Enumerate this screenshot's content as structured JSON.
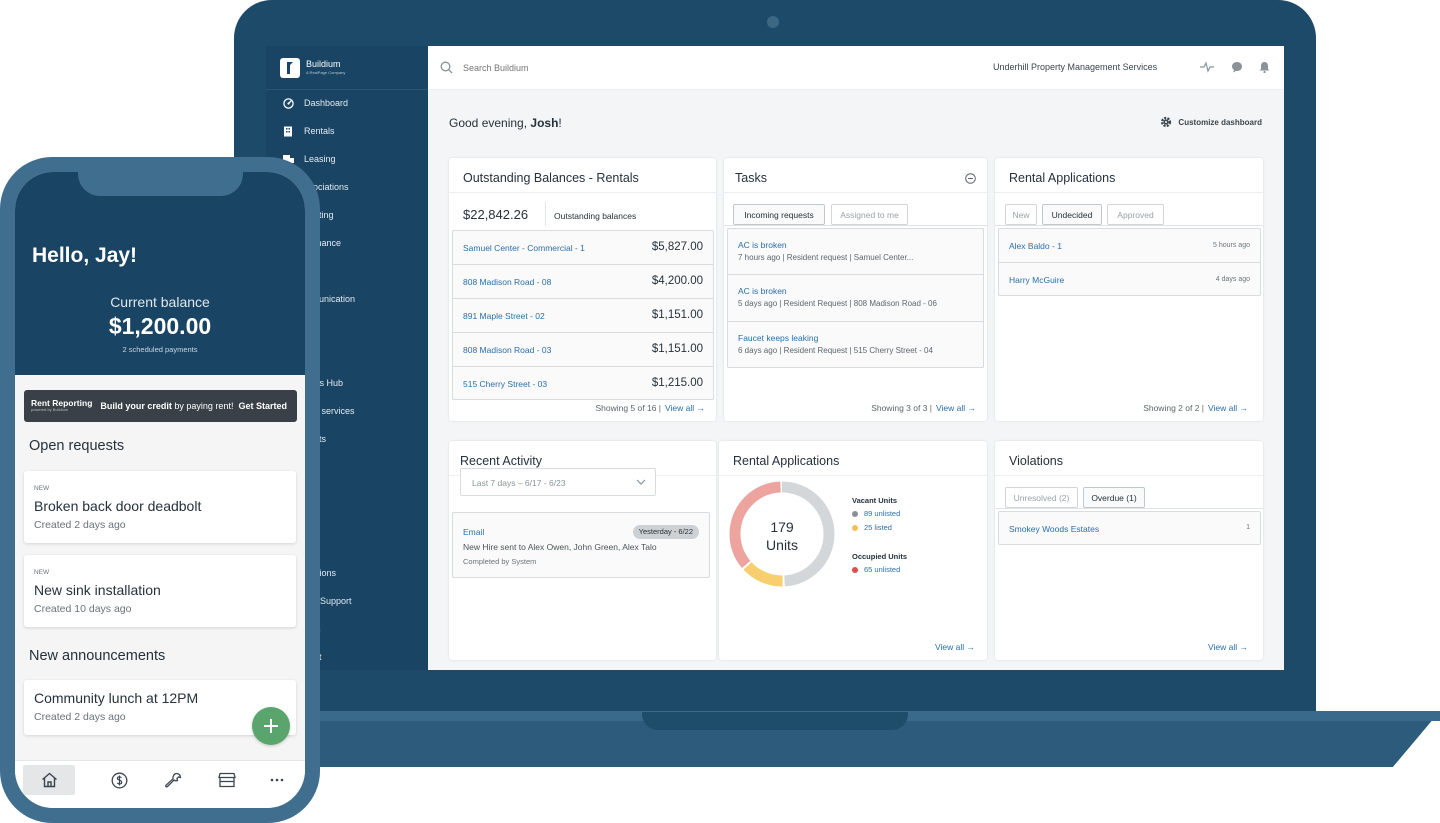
{
  "laptop": {
    "brand": {
      "name": "Buildium",
      "tagline": "A RealPage Company"
    },
    "sidebar": {
      "items": [
        {
          "label": "Dashboard",
          "icon": "dashboard-icon"
        },
        {
          "label": "Rentals",
          "icon": "building-icon"
        },
        {
          "label": "Leasing",
          "icon": "leasing-icon"
        },
        {
          "label": "ssociations"
        },
        {
          "label": "ounting"
        },
        {
          "label": "ntenance"
        },
        {
          "label": "ks"
        },
        {
          "label": "mmunication"
        },
        {
          "label": "s"
        },
        {
          "label": "orts"
        },
        {
          "label": "lytics Hub"
        },
        {
          "label": "l-on services"
        },
        {
          "label": "rtcuts"
        },
        {
          "label": "grations"
        },
        {
          "label": "p & Support"
        },
        {
          "label": "ings"
        },
        {
          "label": "ount"
        }
      ]
    },
    "topbar": {
      "search_placeholder": "Search Buildium",
      "company": "Underhill Property Management Services"
    },
    "greeting": {
      "prefix": "Good evening, ",
      "name": "Josh",
      "suffix": "!"
    },
    "customize_label": "Customize dashboard",
    "outstanding": {
      "title": "Outstanding Balances - Rentals",
      "total": "$22,842.26",
      "total_label": "Outstanding balances",
      "rows": [
        {
          "name": "Samuel Center - Commercial - 1",
          "amount": "$5,827.00"
        },
        {
          "name": "808 Madison Road - 08",
          "amount": "$4,200.00"
        },
        {
          "name": "891 Maple Street - 02",
          "amount": "$1,151.00"
        },
        {
          "name": "808 Madison Road - 03",
          "amount": "$1,151.00"
        },
        {
          "name": "515 Cherry Street - 03",
          "amount": "$1,215.00"
        }
      ],
      "showing": "Showing 5 of 16 |",
      "view_all": "View all →"
    },
    "tasks": {
      "title": "Tasks",
      "tabs": [
        "Incoming requests",
        "Assigned to me"
      ],
      "rows": [
        {
          "title": "AC is broken",
          "sub": "7 hours ago | Resident request | Samuel Center..."
        },
        {
          "title": "AC is broken",
          "sub": "5 days ago | Resident Request | 808 Madison Road - 06"
        },
        {
          "title": "Faucet keeps leaking",
          "sub": "6 days ago | Resident Request | 515 Cherry Street - 04"
        }
      ],
      "showing": "Showing 3 of 3 |",
      "view_all": "View all →"
    },
    "rental_apps_top": {
      "title": "Rental Applications",
      "tabs": [
        "New",
        "Undecided",
        "Approved"
      ],
      "rows": [
        {
          "name": "Alex Baldo - 1",
          "time": "5 hours ago"
        },
        {
          "name": "Harry McGuire",
          "time": "4 days ago"
        }
      ],
      "showing": "Showing 2 of 2 |",
      "view_all": "View all →"
    },
    "recent_activity": {
      "title": "Recent Activity",
      "filter": "Last 7 days – 6/17 - 6/23",
      "item": {
        "type": "Email",
        "date_badge": "Yesterday - 6/22",
        "text": "New Hire sent to Alex Owen, John Green, Alex Talo",
        "by": "Completed by System"
      }
    },
    "rental_apps_chart": {
      "title": "Rental Applications",
      "center_value": "179",
      "center_label": "Units",
      "vacant_heading": "Vacant Units",
      "occupied_heading": "Occupied Units",
      "view_all": "View all →"
    },
    "violations": {
      "title": "Violations",
      "tabs": [
        "Unresolved (2)",
        "Overdue (1)"
      ],
      "rows": [
        {
          "name": "Smokey Woods Estates",
          "count": "1"
        }
      ],
      "view_all": "View all →"
    }
  },
  "chart_data": {
    "type": "pie",
    "title": "Rental Applications",
    "categories": [
      "89 unlisted",
      "25 listed",
      "65 unlisted"
    ],
    "groups": [
      "Vacant Units",
      "Vacant Units",
      "Occupied Units"
    ],
    "values": [
      89,
      25,
      65
    ],
    "colors": [
      "#8a9196",
      "#f3c15c",
      "#d9514a"
    ],
    "total": 179,
    "chart_colors": [
      "#d4d7d9",
      "#f7cf6e",
      "#eda49e"
    ]
  },
  "phone": {
    "greeting": "Hello, Jay!",
    "balance_label": "Current balance",
    "balance": "$1,200.00",
    "scheduled": "2 scheduled payments",
    "banner": {
      "logo": "Rent Reporting",
      "logo_sub": "powered by Buildium",
      "text_bold": "Build your credit",
      "text": " by paying rent!",
      "cta": "Get Started"
    },
    "open_requests_title": "Open requests",
    "requests": [
      {
        "badge": "NEW",
        "title": "Broken back door deadbolt",
        "created": "Created 2 days ago"
      },
      {
        "badge": "NEW",
        "title": "New sink installation",
        "created": "Created 10 days ago"
      }
    ],
    "announcements_title": "New announcements",
    "announcement": {
      "title": "Community lunch at 12PM",
      "created": "Created 2 days ago"
    },
    "nav": [
      "home-icon",
      "dollar-icon",
      "wrench-icon",
      "store-icon",
      "more-icon"
    ]
  },
  "colors": {
    "navy": "#194464",
    "laptop_frame": "#1d4a69",
    "link": "#2a6fa8",
    "fab": "#5aa56e"
  }
}
